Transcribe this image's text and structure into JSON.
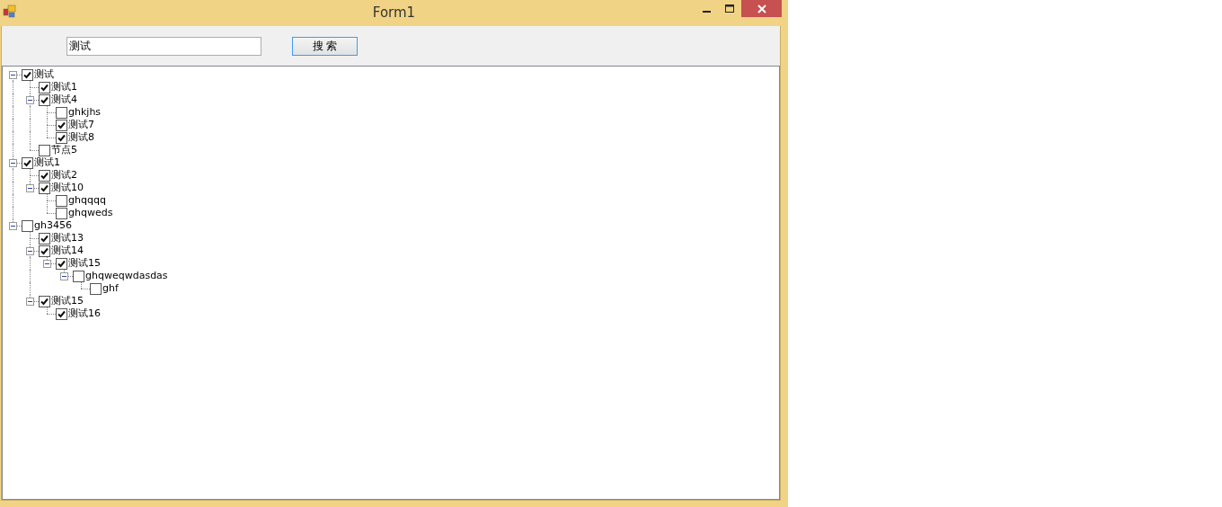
{
  "window": {
    "title": "Form1"
  },
  "search": {
    "value": "测试",
    "button": "搜 索"
  },
  "tree": [
    {
      "label": "测试",
      "checked": true,
      "expanded": true,
      "children": [
        {
          "label": "测试1",
          "checked": true
        },
        {
          "label": "测试4",
          "checked": true,
          "expanded": true,
          "children": [
            {
              "label": "ghkjhs",
              "checked": false
            },
            {
              "label": "测试7",
              "checked": true
            },
            {
              "label": "测试8",
              "checked": true
            }
          ]
        },
        {
          "label": "节点5",
          "checked": false
        }
      ]
    },
    {
      "label": "测试1",
      "checked": true,
      "expanded": true,
      "children": [
        {
          "label": "测试2",
          "checked": true
        },
        {
          "label": "测试10",
          "checked": true,
          "expanded": true,
          "children": [
            {
              "label": "ghqqqq",
              "checked": false
            },
            {
              "label": "ghqweds",
              "checked": false
            }
          ]
        }
      ]
    },
    {
      "label": "gh3456",
      "checked": false,
      "expanded": true,
      "children": [
        {
          "label": "测试13",
          "checked": true
        },
        {
          "label": "测试14",
          "checked": true,
          "expanded": true,
          "children": [
            {
              "label": "测试15",
              "checked": true,
              "expanded": true,
              "children": [
                {
                  "label": "ghqweqwdasdas",
                  "checked": false,
                  "expanded": true,
                  "children": [
                    {
                      "label": "ghf",
                      "checked": false
                    }
                  ]
                }
              ]
            }
          ]
        },
        {
          "label": "测试15",
          "checked": true,
          "expanded": true,
          "children": [
            {
              "label": "测试16",
              "checked": true
            }
          ]
        }
      ]
    }
  ]
}
